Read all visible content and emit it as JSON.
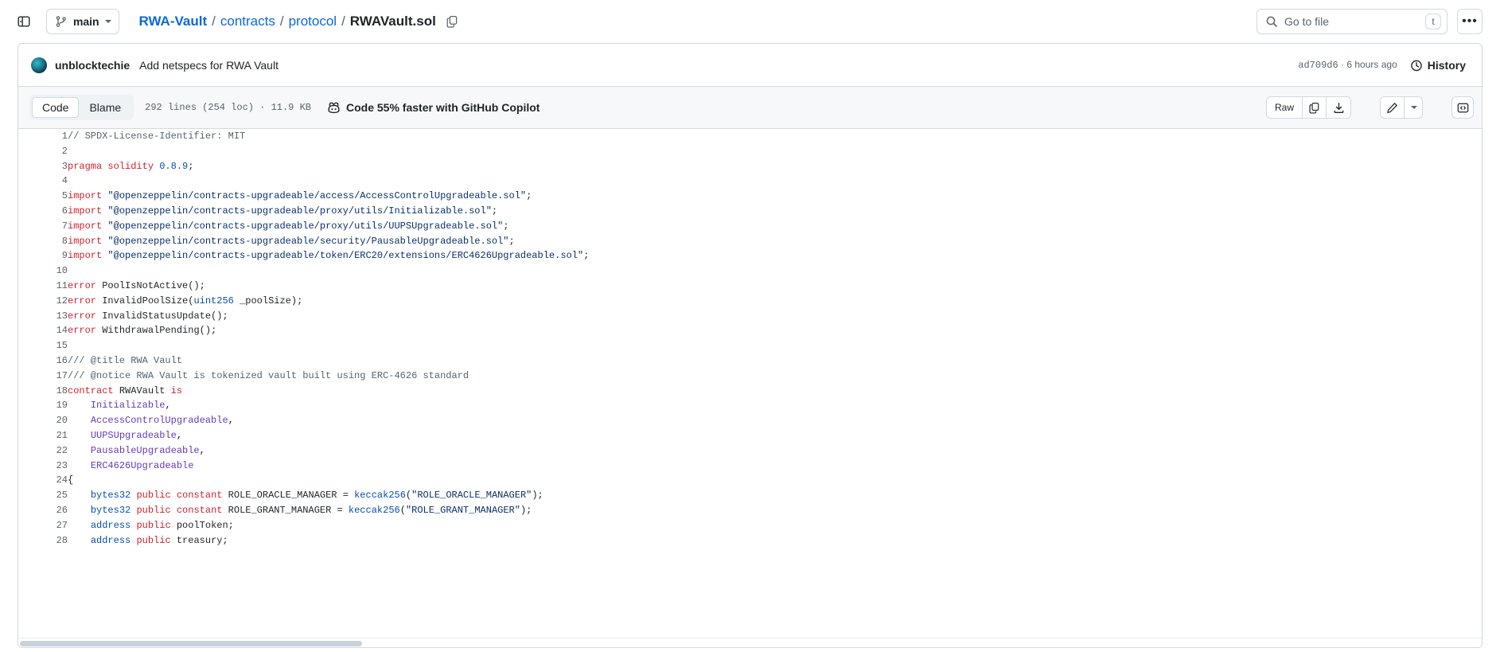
{
  "header": {
    "sidebar_toggle_icon": "sidebar-expand-icon",
    "branch": {
      "icon": "git-branch-icon",
      "name": "main"
    },
    "breadcrumb": {
      "repo": "RWA-Vault",
      "sep": "/",
      "parts": [
        "contracts",
        "protocol"
      ],
      "current": "RWAVault.sol",
      "copy_icon": "copy-path-icon"
    },
    "search": {
      "icon": "search-icon",
      "placeholder": "Go to file",
      "shortcut": "t"
    },
    "overflow_label": "•••"
  },
  "commit": {
    "author": "unblocktechie",
    "message": "Add netspecs for RWA Vault",
    "sha": "ad709d6",
    "separator": " · ",
    "time": "6 hours ago",
    "history_label": "History",
    "history_icon": "history-clock-icon"
  },
  "toolbar": {
    "tabs": [
      {
        "label": "Code",
        "active": true
      },
      {
        "label": "Blame",
        "active": false
      }
    ],
    "file_meta": "292 lines (254 loc) · 11.9 KB",
    "copilot": {
      "icon": "copilot-icon",
      "label": "Code 55% faster with GitHub Copilot"
    },
    "raw_label": "Raw",
    "copy_icon": "copy-raw-icon",
    "download_icon": "download-icon",
    "edit_icon": "pencil-edit-icon",
    "edit_caret_icon": "chevron-down-icon",
    "symbols_icon": "code-symbols-icon"
  },
  "code": {
    "language": "solidity",
    "lines": [
      {
        "n": 1,
        "tokens": [
          {
            "t": "// SPDX-License-Identifier: MIT",
            "c": "tk-comment"
          }
        ]
      },
      {
        "n": 2,
        "tokens": []
      },
      {
        "n": 3,
        "tokens": [
          {
            "t": "pragma",
            "c": "tk-keyword"
          },
          {
            "t": " ",
            "c": "tk-plain"
          },
          {
            "t": "solidity",
            "c": "tk-keyword"
          },
          {
            "t": " ",
            "c": "tk-plain"
          },
          {
            "t": "0.8.9",
            "c": "tk-num"
          },
          {
            "t": ";",
            "c": "tk-plain"
          }
        ]
      },
      {
        "n": 4,
        "tokens": []
      },
      {
        "n": 5,
        "tokens": [
          {
            "t": "import",
            "c": "tk-keyword"
          },
          {
            "t": " ",
            "c": "tk-plain"
          },
          {
            "t": "\"@openzeppelin/contracts-upgradeable/access/AccessControlUpgradeable.sol\"",
            "c": "tk-string"
          },
          {
            "t": ";",
            "c": "tk-plain"
          }
        ]
      },
      {
        "n": 6,
        "tokens": [
          {
            "t": "import",
            "c": "tk-keyword"
          },
          {
            "t": " ",
            "c": "tk-plain"
          },
          {
            "t": "\"@openzeppelin/contracts-upgradeable/proxy/utils/Initializable.sol\"",
            "c": "tk-string"
          },
          {
            "t": ";",
            "c": "tk-plain"
          }
        ]
      },
      {
        "n": 7,
        "tokens": [
          {
            "t": "import",
            "c": "tk-keyword"
          },
          {
            "t": " ",
            "c": "tk-plain"
          },
          {
            "t": "\"@openzeppelin/contracts-upgradeable/proxy/utils/UUPSUpgradeable.sol\"",
            "c": "tk-string"
          },
          {
            "t": ";",
            "c": "tk-plain"
          }
        ]
      },
      {
        "n": 8,
        "tokens": [
          {
            "t": "import",
            "c": "tk-keyword"
          },
          {
            "t": " ",
            "c": "tk-plain"
          },
          {
            "t": "\"@openzeppelin/contracts-upgradeable/security/PausableUpgradeable.sol\"",
            "c": "tk-string"
          },
          {
            "t": ";",
            "c": "tk-plain"
          }
        ]
      },
      {
        "n": 9,
        "tokens": [
          {
            "t": "import",
            "c": "tk-keyword"
          },
          {
            "t": " ",
            "c": "tk-plain"
          },
          {
            "t": "\"@openzeppelin/contracts-upgradeable/token/ERC20/extensions/ERC4626Upgradeable.sol\"",
            "c": "tk-string"
          },
          {
            "t": ";",
            "c": "tk-plain"
          }
        ]
      },
      {
        "n": 10,
        "tokens": []
      },
      {
        "n": 11,
        "tokens": [
          {
            "t": "error",
            "c": "tk-keyword"
          },
          {
            "t": " ",
            "c": "tk-plain"
          },
          {
            "t": "PoolIsNotActive",
            "c": "tk-plain"
          },
          {
            "t": "();",
            "c": "tk-plain"
          }
        ]
      },
      {
        "n": 12,
        "tokens": [
          {
            "t": "error",
            "c": "tk-keyword"
          },
          {
            "t": " ",
            "c": "tk-plain"
          },
          {
            "t": "InvalidPoolSize",
            "c": "tk-plain"
          },
          {
            "t": "(",
            "c": "tk-plain"
          },
          {
            "t": "uint256",
            "c": "tk-type"
          },
          {
            "t": " _poolSize);",
            "c": "tk-plain"
          }
        ]
      },
      {
        "n": 13,
        "tokens": [
          {
            "t": "error",
            "c": "tk-keyword"
          },
          {
            "t": " ",
            "c": "tk-plain"
          },
          {
            "t": "InvalidStatusUpdate",
            "c": "tk-plain"
          },
          {
            "t": "();",
            "c": "tk-plain"
          }
        ]
      },
      {
        "n": 14,
        "tokens": [
          {
            "t": "error",
            "c": "tk-keyword"
          },
          {
            "t": " ",
            "c": "tk-plain"
          },
          {
            "t": "WithdrawalPending",
            "c": "tk-plain"
          },
          {
            "t": "();",
            "c": "tk-plain"
          }
        ]
      },
      {
        "n": 15,
        "tokens": []
      },
      {
        "n": 16,
        "tokens": [
          {
            "t": "/// @title RWA Vault",
            "c": "tk-comment"
          }
        ]
      },
      {
        "n": 17,
        "tokens": [
          {
            "t": "/// @notice RWA Vault is tokenized vault built using ERC-4626 standard",
            "c": "tk-comment"
          }
        ]
      },
      {
        "n": 18,
        "tokens": [
          {
            "t": "contract",
            "c": "tk-keyword"
          },
          {
            "t": " ",
            "c": "tk-plain"
          },
          {
            "t": "RWAVault",
            "c": "tk-plain"
          },
          {
            "t": " ",
            "c": "tk-plain"
          },
          {
            "t": "is",
            "c": "tk-keyword"
          }
        ]
      },
      {
        "n": 19,
        "tokens": [
          {
            "t": "    ",
            "c": "tk-plain"
          },
          {
            "t": "Initializable",
            "c": "tk-entity"
          },
          {
            "t": ",",
            "c": "tk-plain"
          }
        ]
      },
      {
        "n": 20,
        "tokens": [
          {
            "t": "    ",
            "c": "tk-plain"
          },
          {
            "t": "AccessControlUpgradeable",
            "c": "tk-entity"
          },
          {
            "t": ",",
            "c": "tk-plain"
          }
        ]
      },
      {
        "n": 21,
        "tokens": [
          {
            "t": "    ",
            "c": "tk-plain"
          },
          {
            "t": "UUPSUpgradeable",
            "c": "tk-entity"
          },
          {
            "t": ",",
            "c": "tk-plain"
          }
        ]
      },
      {
        "n": 22,
        "tokens": [
          {
            "t": "    ",
            "c": "tk-plain"
          },
          {
            "t": "PausableUpgradeable",
            "c": "tk-entity"
          },
          {
            "t": ",",
            "c": "tk-plain"
          }
        ]
      },
      {
        "n": 23,
        "tokens": [
          {
            "t": "    ",
            "c": "tk-plain"
          },
          {
            "t": "ERC4626Upgradeable",
            "c": "tk-entity"
          }
        ]
      },
      {
        "n": 24,
        "tokens": [
          {
            "t": "{",
            "c": "tk-plain"
          }
        ]
      },
      {
        "n": 25,
        "tokens": [
          {
            "t": "    ",
            "c": "tk-plain"
          },
          {
            "t": "bytes32",
            "c": "tk-type"
          },
          {
            "t": " ",
            "c": "tk-plain"
          },
          {
            "t": "public",
            "c": "tk-keyword"
          },
          {
            "t": " ",
            "c": "tk-plain"
          },
          {
            "t": "constant",
            "c": "tk-keyword"
          },
          {
            "t": " ROLE_ORACLE_MANAGER = ",
            "c": "tk-plain"
          },
          {
            "t": "keccak256",
            "c": "tk-fn"
          },
          {
            "t": "(",
            "c": "tk-plain"
          },
          {
            "t": "\"ROLE_ORACLE_MANAGER\"",
            "c": "tk-string"
          },
          {
            "t": ");",
            "c": "tk-plain"
          }
        ]
      },
      {
        "n": 26,
        "tokens": [
          {
            "t": "    ",
            "c": "tk-plain"
          },
          {
            "t": "bytes32",
            "c": "tk-type"
          },
          {
            "t": " ",
            "c": "tk-plain"
          },
          {
            "t": "public",
            "c": "tk-keyword"
          },
          {
            "t": " ",
            "c": "tk-plain"
          },
          {
            "t": "constant",
            "c": "tk-keyword"
          },
          {
            "t": " ROLE_GRANT_MANAGER = ",
            "c": "tk-plain"
          },
          {
            "t": "keccak256",
            "c": "tk-fn"
          },
          {
            "t": "(",
            "c": "tk-plain"
          },
          {
            "t": "\"ROLE_GRANT_MANAGER\"",
            "c": "tk-string"
          },
          {
            "t": ");",
            "c": "tk-plain"
          }
        ]
      },
      {
        "n": 27,
        "tokens": [
          {
            "t": "    ",
            "c": "tk-plain"
          },
          {
            "t": "address",
            "c": "tk-type"
          },
          {
            "t": " ",
            "c": "tk-plain"
          },
          {
            "t": "public",
            "c": "tk-keyword"
          },
          {
            "t": " poolToken;",
            "c": "tk-plain"
          }
        ]
      },
      {
        "n": 28,
        "tokens": [
          {
            "t": "    ",
            "c": "tk-plain"
          },
          {
            "t": "address",
            "c": "tk-type"
          },
          {
            "t": " ",
            "c": "tk-plain"
          },
          {
            "t": "public",
            "c": "tk-keyword"
          },
          {
            "t": " treasury;",
            "c": "tk-plain"
          }
        ]
      }
    ]
  }
}
